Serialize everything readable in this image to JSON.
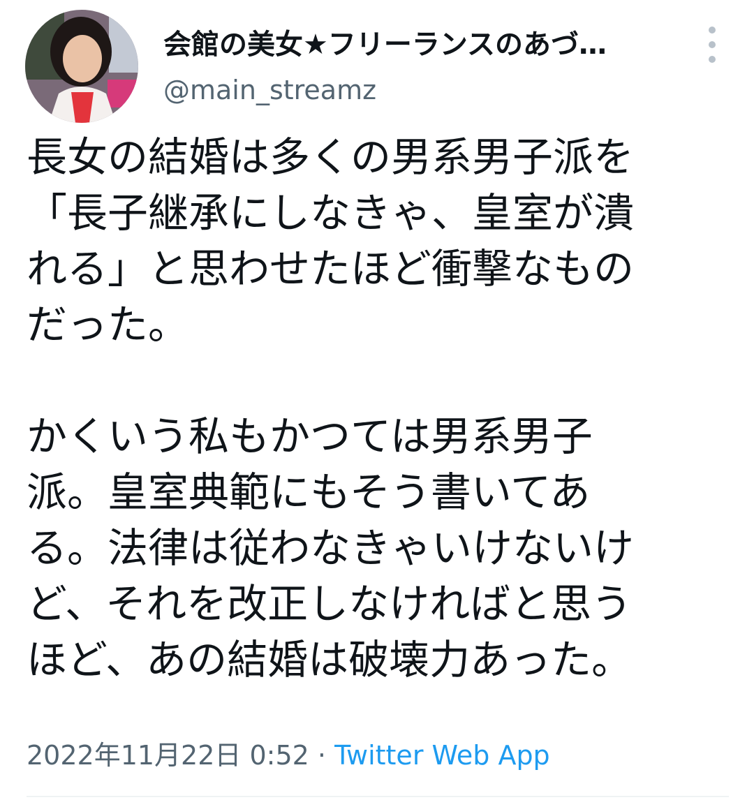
{
  "tweet": {
    "author": {
      "display_name": "会館の美女★フリーランスのあづ…",
      "handle": "@main_streamz",
      "avatar_icon": "profile-photo"
    },
    "more_icon": "vertical-dots-icon",
    "text_paragraphs": [
      [
        "長女の結婚は多くの男系男子派を",
        "「長子継承にしなきゃ、皇室が潰",
        "れる」と思わせたほど衝撃なもの",
        "だった。"
      ],
      [
        "かくいう私もかつては男系男子",
        "派。皇室典範にもそう書いてあ",
        "る。法律は従わなきゃいけないけ",
        "ど、それを改正しなければと思う",
        "ほど、あの結婚は破壊力あった。"
      ]
    ],
    "timestamp": "2022年11月22日 0:52",
    "separator": " · ",
    "source": "Twitter Web App"
  },
  "colors": {
    "text": "#0f1419",
    "secondary": "#536471",
    "link": "#1d9bf0"
  }
}
